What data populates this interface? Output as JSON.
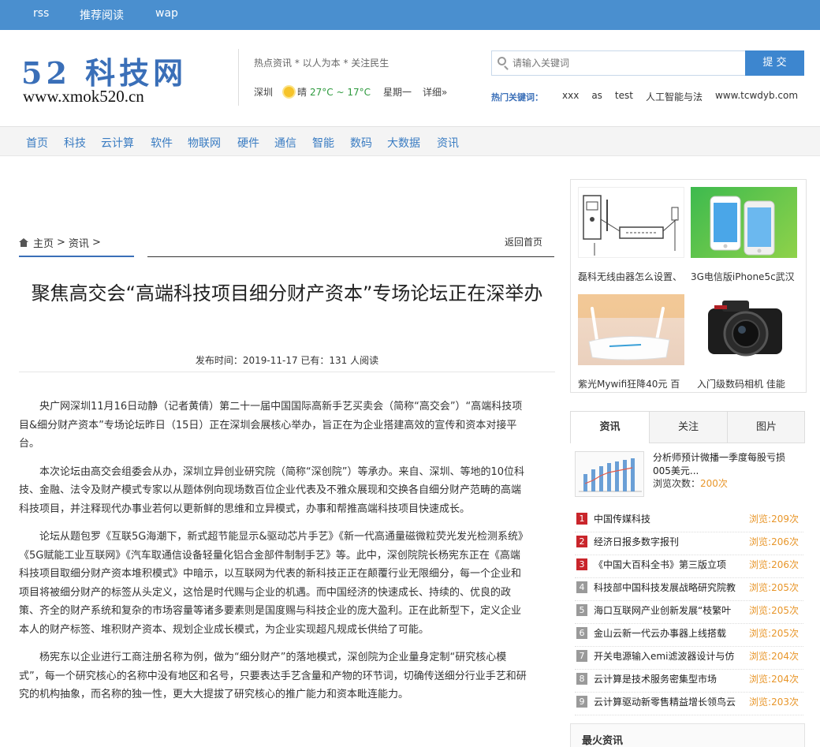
{
  "topnav": [
    "rss",
    "推荐阅读",
    "wap"
  ],
  "logo": {
    "main": "52 科技网",
    "url": "www.xmok520.cn"
  },
  "slogan": "热点资讯 * 以人为本 * 关注民生",
  "weather": {
    "city": "深圳",
    "condition": "晴",
    "temp": "27°C ~ 17°C",
    "weekday": "星期一",
    "detail": "详细»"
  },
  "search": {
    "placeholder": "请输入关键词",
    "button": "提 交"
  },
  "hot_keywords": {
    "label": "热门关键词：",
    "items": [
      "xxx",
      "as",
      "test",
      "人工智能与法",
      "www.tcwdyb.com"
    ]
  },
  "mainnav": [
    "首页",
    "科技",
    "云计算",
    "软件",
    "物联网",
    "硬件",
    "通信",
    "智能",
    "数码",
    "大数据",
    "资讯"
  ],
  "breadcrumb": {
    "home": "主页",
    "section": "资讯",
    "sep": ">",
    "back": "返回首页"
  },
  "article": {
    "title": "聚焦高交会“高端科技项目细分财产资本”专场论坛正在深举办",
    "meta": "发布时间：2019-11-17 已有：131 人阅读",
    "paragraphs": [
      "央广网深圳11月16日动静（记者黄倩）第二十一届中国国际高新手艺买卖会（简称“高交会”）“高端科技项目&细分财产资本”专场论坛昨日（15日）正在深圳会展核心举办，旨正在为企业搭建高效的宣传和资本对接平台。",
      "本次论坛由高交会组委会从办，深圳立异创业研究院（简称“深创院”）等承办。来自、深圳、等地的10位科技、金融、法令及财产模式专家以从题体例向现场数百位企业代表及不雅众展现和交换各自细分财产范畴的高端科技项目，并注释现代办事业若何以更新鲜的思维和立异模式，办事和帮推高端科技项目快速成长。",
      "论坛从题包罗《互联5G海潮下，新式超节能显示&驱动芯片手艺》《新一代高通量磁微粒荧光发光检测系统》《5G赋能工业互联网》《汽车取通信设备轻量化铝合金部件制制手艺》等。此中，深创院院长杨宪东正在《高端科技项目取细分财产资本堆积模式》中暗示，以互联网为代表的新科技正正在颠覆行业无限细分，每一个企业和项目将被细分财产的标签从头定义，这恰是时代赐与企业的机遇。而中国经济的快速成长、持续的、优良的政策、齐全的财产系统和复杂的市场容量等诸多要素则是国度赐与科技企业的庞大盈利。正在此新型下，定义企业本人的财产标签、堆积财产资本、规划企业成长模式，为企业实现超凡规成长供给了可能。",
      "杨宪东以企业进行工商注册名称为例，做为“细分财产”的落地模式，深创院为企业量身定制“研究核心模式”，每一个研究核心的名称中没有地区和名号，只要表达手艺含量和产物的环节词，切确传送细分行业手艺和研究的机构抽象，而名称的独一性，更大大提拔了研究核心的推广能力和资本毗连能力。"
    ]
  },
  "pictures": [
    {
      "caption": "磊科无线由器怎么设置、"
    },
    {
      "caption": "3G电信版iPhone5c武汉"
    },
    {
      "caption": "紫光Mywifi狂降40元 百"
    },
    {
      "caption": "入门级数码相机 佳能"
    }
  ],
  "tabs": [
    "资讯",
    "关注",
    "图片"
  ],
  "featured": {
    "title": "分析师预计微播一季度每股亏损005美元...",
    "views_label": "浏览次数：",
    "views": "200次"
  },
  "ranked_list": [
    {
      "rank": "1",
      "title": "中国传媒科技",
      "views": "浏览:209次",
      "color": "#c9252b"
    },
    {
      "rank": "2",
      "title": "经济日报多数字报刊",
      "views": "浏览:206次",
      "color": "#c9252b"
    },
    {
      "rank": "3",
      "title": "《中国大百科全书》第三版立项",
      "views": "浏览:206次",
      "color": "#c9252b"
    },
    {
      "rank": "4",
      "title": "科技部中国科技发展战略研究院教",
      "views": "浏览:205次",
      "color": "#9a9a9a"
    },
    {
      "rank": "5",
      "title": "海口互联网产业创新发展“枝繁叶",
      "views": "浏览:205次",
      "color": "#9a9a9a"
    },
    {
      "rank": "6",
      "title": "金山云新一代云办事器上线搭载",
      "views": "浏览:205次",
      "color": "#9a9a9a"
    },
    {
      "rank": "7",
      "title": "开关电源输入emi滤波器设计与仿",
      "views": "浏览:204次",
      "color": "#9a9a9a"
    },
    {
      "rank": "8",
      "title": "云计算是技术服务密集型市场",
      "views": "浏览:204次",
      "color": "#9a9a9a"
    },
    {
      "rank": "9",
      "title": "云计算驱动新零售精益增长领鸟云",
      "views": "浏览:203次",
      "color": "#9a9a9a"
    }
  ],
  "hot_box_title": "最火资讯"
}
